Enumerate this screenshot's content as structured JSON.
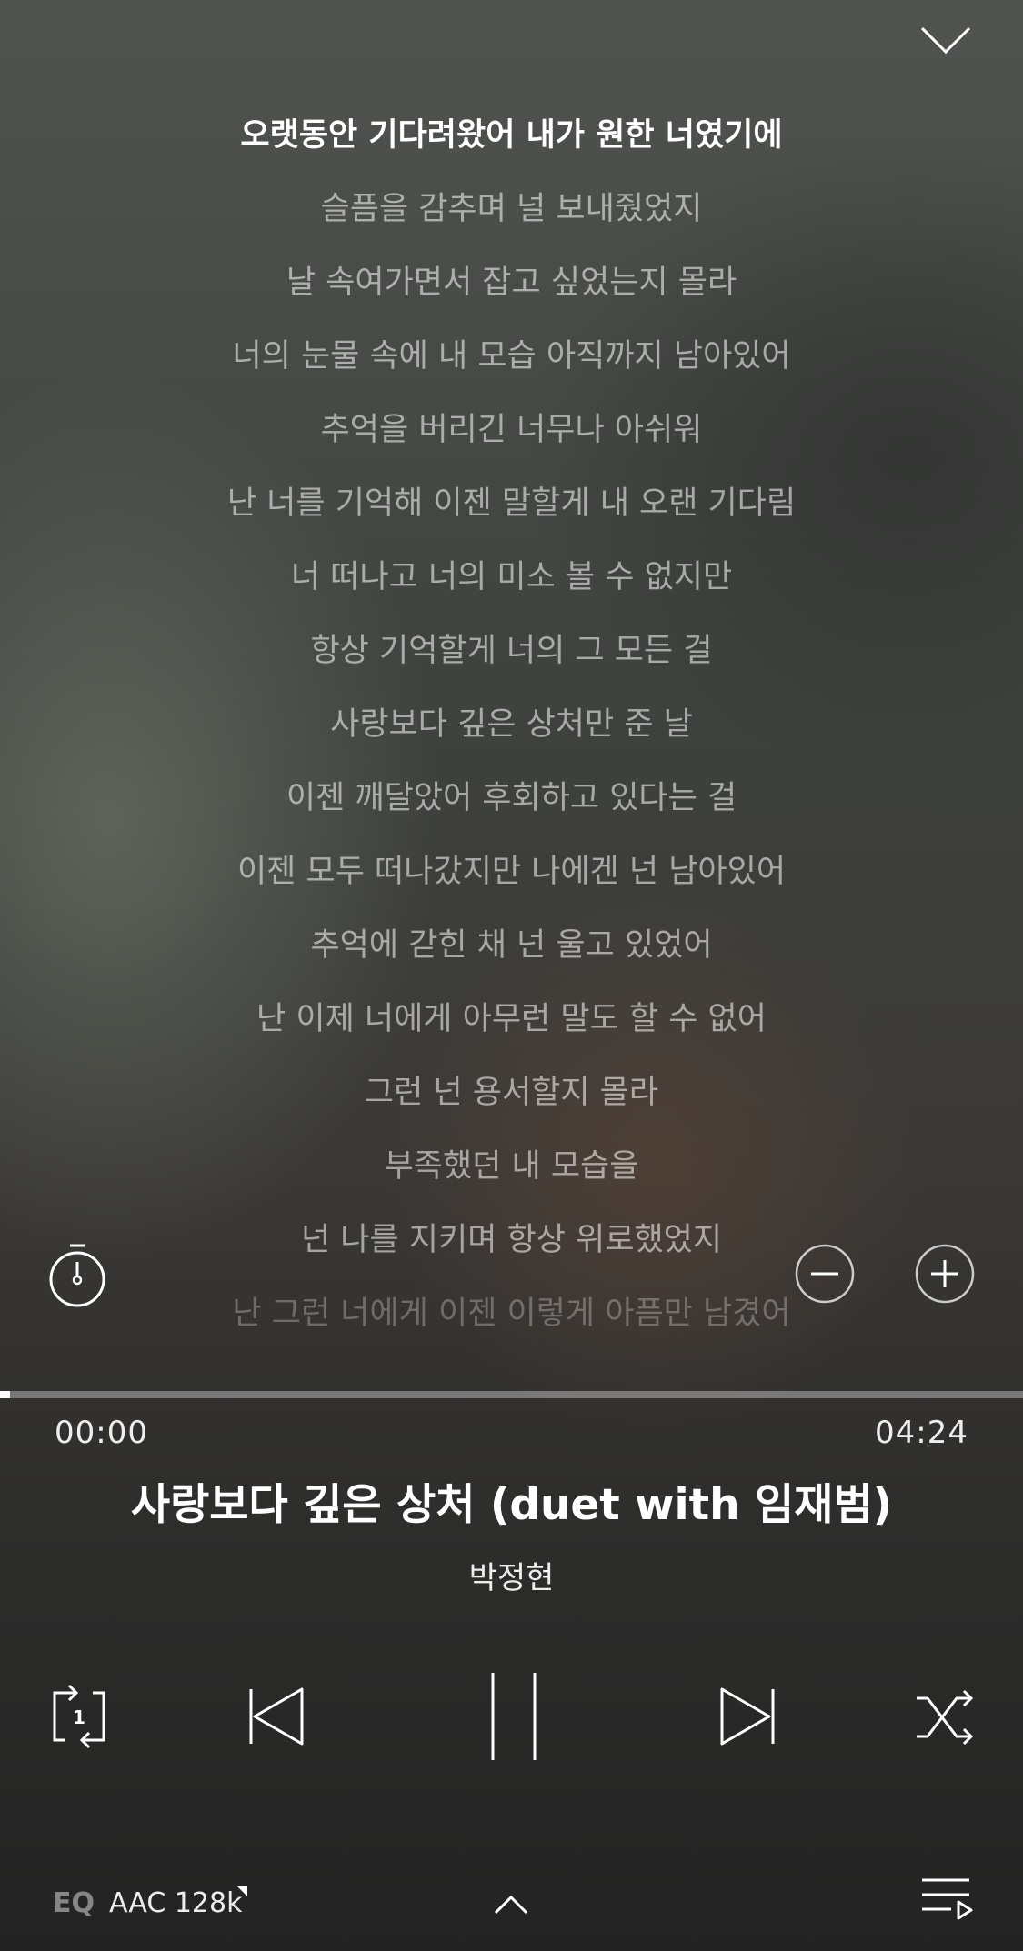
{
  "header": {
    "close_icon": "chevron-down-icon"
  },
  "lyrics": {
    "current_index": 0,
    "lines": [
      "오랫동안 기다려왔어 내가 원한 너였기에",
      "슬픔을 감추며 널 보내줬었지",
      "날 속여가면서 잡고 싶었는지 몰라",
      "너의 눈물 속에 내 모습 아직까지 남아있어",
      "추억을 버리긴 너무나 아쉬워",
      "난 너를 기억해 이젠 말할게 내 오랜 기다림",
      "너 떠나고 너의 미소 볼 수 없지만",
      "항상 기억할게 너의 그 모든 걸",
      "사랑보다 깊은 상처만 준 날",
      "이젠 깨달았어 후회하고 있다는 걸",
      "이젠 모두 떠나갔지만 나에겐 넌 남아있어",
      "추억에 갇힌 채 넌 울고 있었어",
      "난 이제 너에게 아무런 말도 할 수 없어",
      "그런 넌 용서할지 몰라",
      "부족했던 내 모습을",
      "넌 나를 지키며 항상 위로했었지",
      "난 그런 너에게 이젠 이렇게 아픔만 남겼어"
    ]
  },
  "lyric_controls": {
    "timer_icon": "stopwatch-icon",
    "font_smaller_icon": "minus-circle-icon",
    "font_larger_icon": "plus-circle-icon"
  },
  "player": {
    "progress": 0.01,
    "time_elapsed": "00:00",
    "time_total": "04:24",
    "title": "사랑보다 깊은 상처 (duet with 임재범)",
    "artist": "박정현"
  },
  "transport": {
    "repeat_icon": "repeat-one-icon",
    "prev_icon": "skip-previous-icon",
    "pause_icon": "pause-icon",
    "next_icon": "skip-next-icon",
    "shuffle_icon": "shuffle-icon"
  },
  "footer": {
    "eq_label": "EQ",
    "quality_label": "AAC 128k",
    "expand_icon": "chevron-up-icon",
    "playlist_icon": "playlist-icon"
  }
}
